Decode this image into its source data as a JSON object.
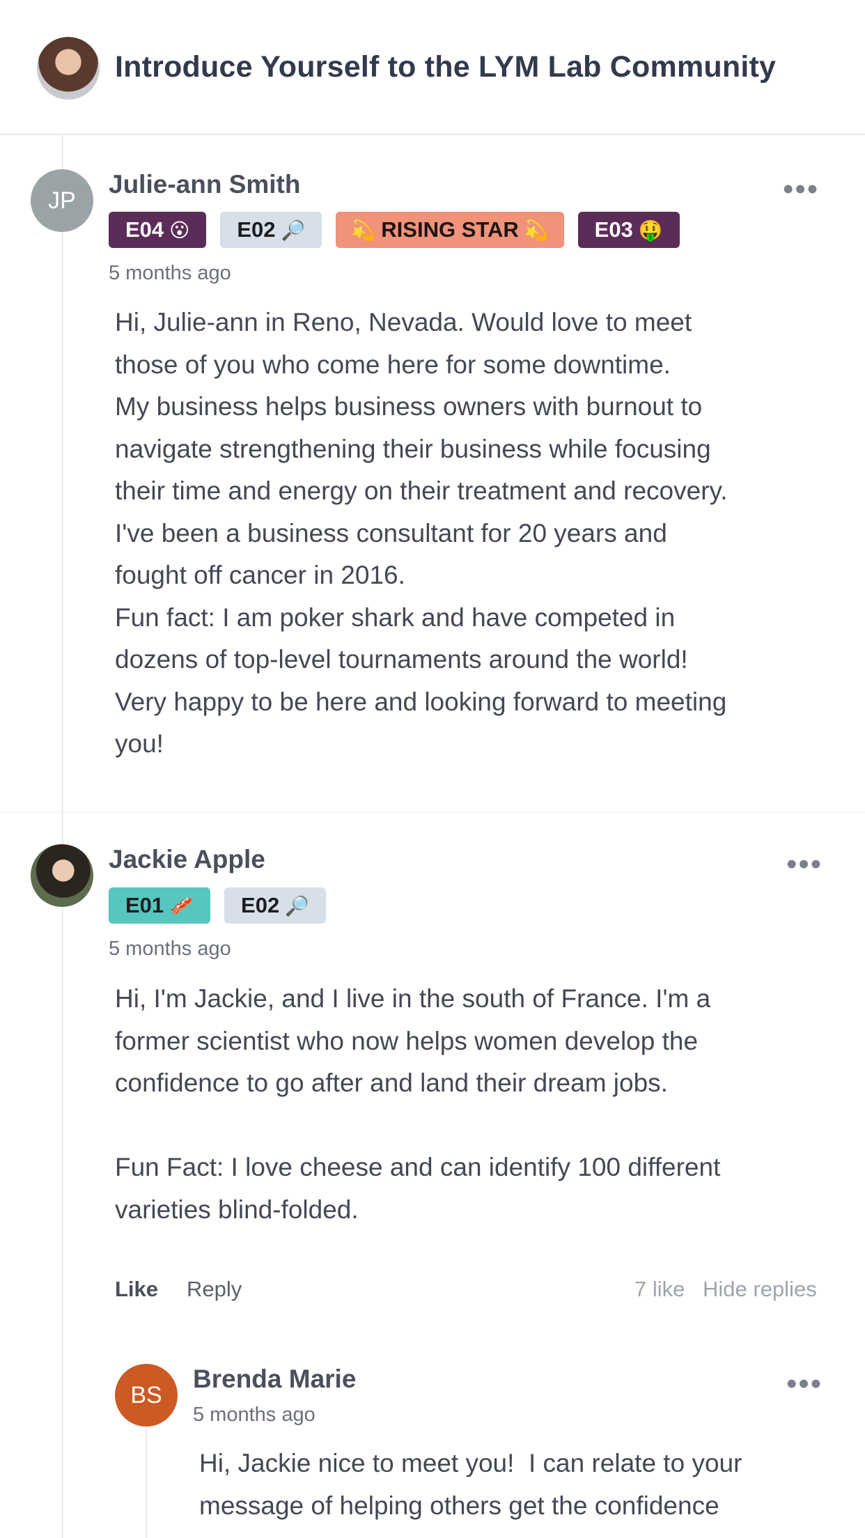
{
  "header": {
    "title": "Introduce Yourself to the LYM Lab Community"
  },
  "posts": [
    {
      "author": "Julie-ann Smith",
      "avatar_initials": "JP",
      "badges": [
        {
          "label": "E04",
          "emoji": "😮"
        },
        {
          "label": "E02",
          "emoji": "🔎"
        },
        {
          "label": "RISING STAR",
          "emoji_left": "💫",
          "emoji_right": "💫"
        },
        {
          "label": "E03",
          "emoji": "🤑"
        }
      ],
      "time": "5 months ago",
      "body": "Hi, Julie-ann in Reno, Nevada. Would love to meet\nthose of you who come here for some downtime.\nMy business helps business owners with burnout to\nnavigate strengthening their business while focusing\ntheir time and energy on their treatment and recovery.\nI've been a business consultant for 20 years and\nfought off cancer in 2016.\nFun fact: I am poker shark and have competed in\ndozens of top-level tournaments around the world!\nVery happy to be here and looking forward to meeting\nyou!",
      "more_label": "•••"
    },
    {
      "author": "Jackie Apple",
      "badges": [
        {
          "label": "E01",
          "emoji": "🥓"
        },
        {
          "label": "E02",
          "emoji": "🔎"
        }
      ],
      "time": "5 months ago",
      "body": "Hi, I'm Jackie, and I live in the south of France. I'm a\nformer scientist who now helps women develop the\nconfidence to go after and land their dream jobs.\n\nFun Fact: I love cheese and can identify 100 different\nvarieties blind-folded.",
      "more_label": "•••",
      "actions": {
        "like": "Like",
        "reply": "Reply",
        "like_count": "7 like",
        "hide_replies": "Hide replies"
      }
    }
  ],
  "reply": {
    "author": "Brenda Marie",
    "avatar_initials": "BS",
    "time": "5 months ago",
    "body": "Hi, Jackie nice to meet you!  I can relate to your\nmessage of helping others get the confidence",
    "more_label": "•••"
  },
  "colors": {
    "badge_purple": "#5c2c58",
    "badge_grey": "#d7dfe8",
    "badge_orange": "#f0937a",
    "badge_teal": "#56c6be",
    "avatar_bs": "#cc5a24",
    "avatar_jp": "#9aa4a6"
  }
}
